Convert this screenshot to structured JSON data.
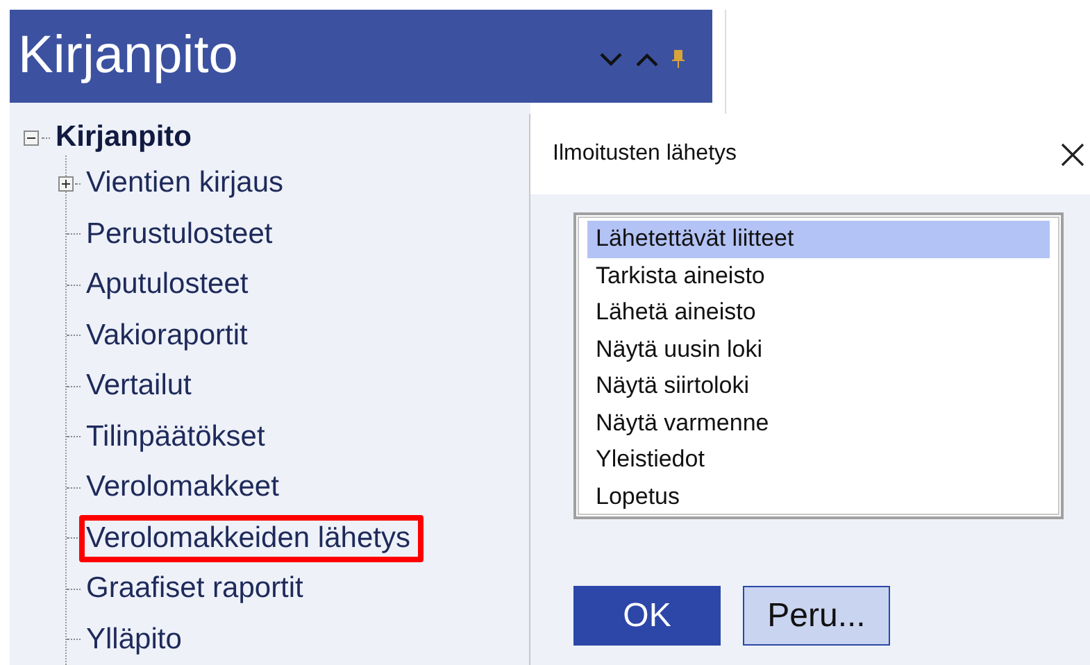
{
  "panel": {
    "title": "Kirjanpito"
  },
  "tree": {
    "label": "Kirjanpito",
    "expanded": true,
    "children": [
      {
        "label": "Vientien kirjaus",
        "kind": "folder",
        "expanded": false,
        "highlighted": false
      },
      {
        "label": "Perustulosteet",
        "kind": "leaf",
        "highlighted": false
      },
      {
        "label": "Aputulosteet",
        "kind": "leaf",
        "highlighted": false
      },
      {
        "label": "Vakioraportit",
        "kind": "leaf",
        "highlighted": false
      },
      {
        "label": "Vertailut",
        "kind": "leaf",
        "highlighted": false
      },
      {
        "label": "Tilinpäätökset",
        "kind": "leaf",
        "highlighted": false
      },
      {
        "label": "Verolomakkeet",
        "kind": "leaf",
        "highlighted": false
      },
      {
        "label": "Verolomakkeiden lähetys",
        "kind": "leaf",
        "highlighted": true
      },
      {
        "label": "Graafiset raportit",
        "kind": "leaf",
        "highlighted": false
      },
      {
        "label": "Ylläpito",
        "kind": "leaf",
        "highlighted": false
      }
    ]
  },
  "dialog": {
    "title": "Ilmoitusten lähetys",
    "options": [
      {
        "label": "Lähetettävät liitteet",
        "selected": true
      },
      {
        "label": "Tarkista aineisto",
        "selected": false
      },
      {
        "label": "Lähetä aineisto",
        "selected": false
      },
      {
        "label": "Näytä uusin loki",
        "selected": false
      },
      {
        "label": "Näytä siirtoloki",
        "selected": false
      },
      {
        "label": "Näytä varmenne",
        "selected": false
      },
      {
        "label": "Yleistiedot",
        "selected": false
      },
      {
        "label": "Lopetus",
        "selected": false
      }
    ],
    "buttons": [
      {
        "label": "OK",
        "kind": "primary"
      },
      {
        "label": "Peru...",
        "kind": "secondary"
      }
    ]
  }
}
